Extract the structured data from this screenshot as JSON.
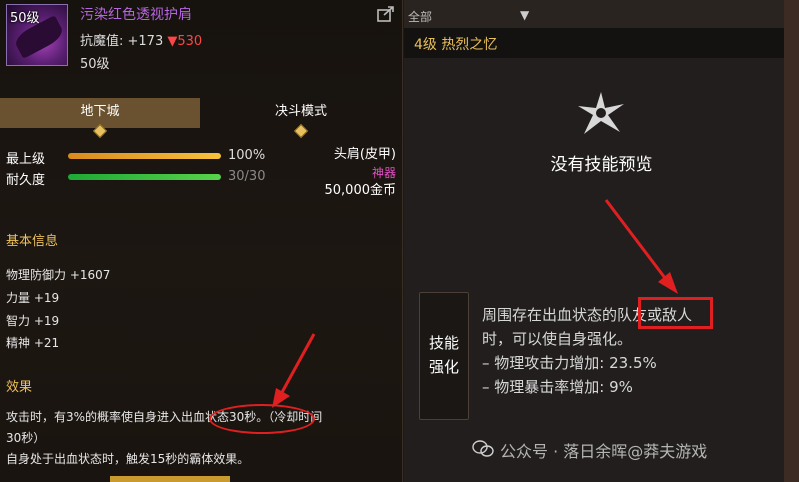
{
  "item": {
    "level_badge": "50级",
    "name": "污染红色透视护肩",
    "resist_label": "抗魔值: +173",
    "resist_down": "▼530",
    "level": "50级"
  },
  "tabs": {
    "dungeon": "地下城",
    "duel": "决斗模式"
  },
  "stats": {
    "top_level_label": "最上级",
    "top_level_value": "100%",
    "top_level_fraction": 1.0,
    "durability_label": "耐久度",
    "durability_value": "30/30",
    "durability_fraction": 1.0
  },
  "slot": {
    "type": "头肩(皮甲)",
    "grade": "神器",
    "price": "50,000金币"
  },
  "basic": {
    "title": "基本信息",
    "lines": [
      "物理防御力 +1607",
      "力量 +19",
      "智力 +19",
      "精神 +21"
    ]
  },
  "effect": {
    "title": "效果",
    "line1": "攻击时，有3%的概率使自身进入出血状态30秒。（冷却时间",
    "line2": "30秒）",
    "line3": "自身处于出血状态时，触发15秒的霸体效果。"
  },
  "right": {
    "dropdown": "全部",
    "skill_title": "4级 热烈之忆",
    "no_skill": "没有技能预览",
    "strengthen_tab_1": "技能",
    "strengthen_tab_2": "强化",
    "desc_1": "周围存在出血状态的队友或敌人",
    "desc_2": "时，可以使自身强化。",
    "desc_3": "– 物理攻击力增加: 23.5%",
    "desc_4": "– 物理暴击率增加: 9%"
  },
  "watermark": "公众号 · 落日余晖@莽夫游戏",
  "colors": {
    "item_name": "#b765e0",
    "resist_down": "#ff4545",
    "section_title": "#eec15a",
    "grade": "#e04fc4",
    "highlight": "#e02020"
  }
}
